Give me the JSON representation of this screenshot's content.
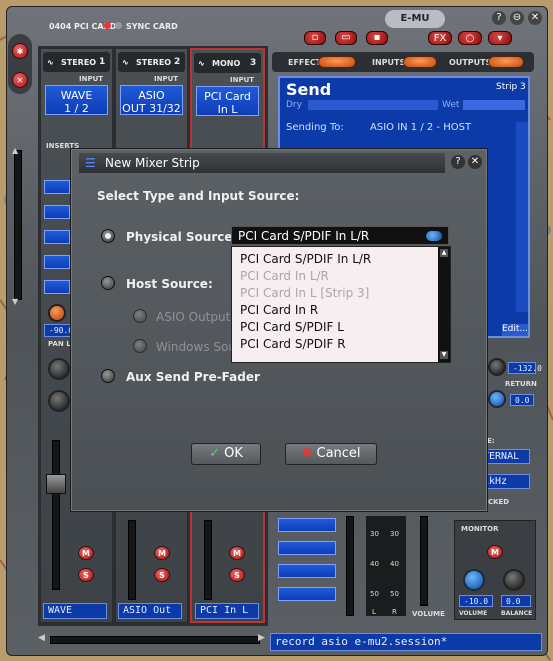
{
  "window": {
    "device": "0404 PCI CARD",
    "sync": "SYNC CARD",
    "brand": "E-MU",
    "help_glyph": "?",
    "min_glyph": "⊖",
    "close_glyph": "✕"
  },
  "toolbar": {
    "fx_label": "FX"
  },
  "left_buttons": {
    "top_glyph": "✱",
    "bottom_glyph": "✕"
  },
  "strips": [
    {
      "type": "STEREO",
      "num": "1",
      "input_label": "INPUT",
      "input_line1": "WAVE",
      "input_line2": "1 / 2",
      "name": "WAVE"
    },
    {
      "type": "STEREO",
      "num": "2",
      "input_label": "INPUT",
      "input_line1": "ASIO",
      "input_line2": "OUT 31/32",
      "name": "ASIO Out"
    },
    {
      "type": "MONO",
      "num": "3",
      "input_label": "INPUT",
      "input_line1": "PCI Card",
      "input_line2": "In L",
      "name": "PCI In L"
    }
  ],
  "inserts_label": "INSERTS",
  "pan_label": "PAN L",
  "pan_value": "-90.0",
  "mute_label": "M",
  "solo_label": "S",
  "tabs": {
    "effect": "EFFECT",
    "inputs": "INPUTS",
    "outputs": "OUTPUTS"
  },
  "send_panel": {
    "title": "Send",
    "strip": "Strip 3",
    "dry": "Dry",
    "wet": "Wet",
    "sending_to_label": "Sending To:",
    "sending_to_value": "ASIO IN 1 / 2 - HOST",
    "edit": "Edit..."
  },
  "return_section": {
    "value": "-132.0",
    "label": "RETURN",
    "value2": "0.0"
  },
  "clock": {
    "source_label": "CE:",
    "internal": "TERNAL",
    "rate": "1kHz",
    "locked": "OCKED"
  },
  "meter": {
    "ticks": [
      "30",
      "30",
      "40",
      "40",
      "50",
      "50"
    ],
    "l": "L",
    "r": "R",
    "volume_label": "VOLUME"
  },
  "monitor": {
    "label": "MONITOR",
    "mute": "M",
    "volume_value": "-10.0",
    "balance_value": "0.0",
    "volume_label": "VOLUME",
    "balance_label": "BALANCE"
  },
  "status_bar": "record asio e-mu2.session*",
  "dialog": {
    "title": "New Mixer Strip",
    "help": "?",
    "close": "✕",
    "heading": "Select Type and Input Source:",
    "physical_label": "Physical Source:",
    "physical_value": "PCI Card S/PDIF In L/R",
    "host_label": "Host Source:",
    "asio_option": "ASIO Output S",
    "windows_option": "Windows Sou",
    "aux_label": "Aux Send Pre-Fader",
    "ok": "OK",
    "cancel": "Cancel",
    "dropdown_items": [
      {
        "label": "PCI Card S/PDIF In L/R",
        "disabled": false
      },
      {
        "label": "PCI Card In L/R",
        "disabled": true
      },
      {
        "label": "PCI Card In L [Strip 3]",
        "disabled": true
      },
      {
        "label": "PCI Card In R",
        "disabled": false
      },
      {
        "label": "PCI Card S/PDIF L",
        "disabled": false
      },
      {
        "label": "PCI Card S/PDIF R",
        "disabled": false
      }
    ]
  },
  "colors": {
    "accent_blue": "#1f5bd8",
    "frame": "#4f5459",
    "red": "#c11",
    "orange": "#e6691e"
  }
}
